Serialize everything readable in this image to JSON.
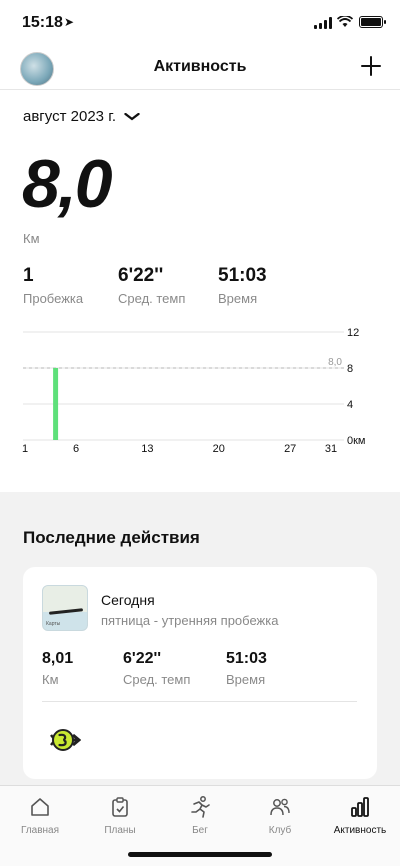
{
  "status_bar": {
    "time": "15:18"
  },
  "header": {
    "title": "Активность"
  },
  "month_selector": {
    "label": "август 2023 г."
  },
  "summary": {
    "distance": "8,0",
    "distance_unit": "Км",
    "stats": [
      {
        "value": "1",
        "label": "Пробежка"
      },
      {
        "value": "6'22''",
        "label": "Сред. темп"
      },
      {
        "value": "51:03",
        "label": "Время"
      }
    ]
  },
  "chart_data": {
    "type": "bar",
    "x_ticks": [
      "1",
      "6",
      "13",
      "20",
      "27",
      "31"
    ],
    "y_ticks": [
      "12",
      "8",
      "4",
      "0км"
    ],
    "ylim": [
      0,
      12
    ],
    "xlim": [
      1,
      31
    ],
    "bars": [
      {
        "day": 4,
        "value": 8.0
      }
    ],
    "reference_line": {
      "value": 8.0,
      "label": "8,0"
    },
    "bar_color": "#5ee07a",
    "grid": true
  },
  "recent": {
    "title": "Последние действия",
    "card": {
      "map_label": "Карты",
      "title": "Сегодня",
      "subtitle": "пятница - утренняя пробежка",
      "stats": [
        {
          "value": "8,01",
          "label": "Км"
        },
        {
          "value": "6'22''",
          "label": "Сред. темп"
        },
        {
          "value": "51:03",
          "label": "Время"
        }
      ]
    }
  },
  "tabbar": {
    "tabs": [
      {
        "label": "Главная",
        "icon": "home-icon"
      },
      {
        "label": "Планы",
        "icon": "clipboard-icon"
      },
      {
        "label": "Бег",
        "icon": "runner-icon"
      },
      {
        "label": "Клуб",
        "icon": "people-icon"
      },
      {
        "label": "Активность",
        "icon": "bar-chart-icon",
        "active": true
      }
    ]
  }
}
